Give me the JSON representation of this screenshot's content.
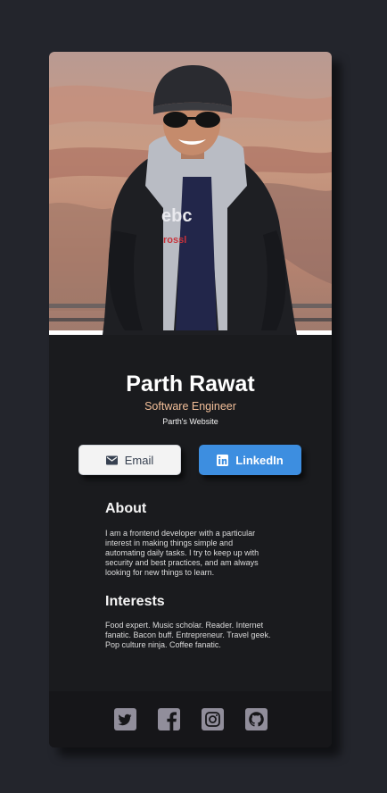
{
  "profile": {
    "name": "Parth Rawat",
    "title": "Software Engineer",
    "website_label": "Parth's Website"
  },
  "buttons": {
    "email_label": "Email",
    "linkedin_label": "LinkedIn"
  },
  "about": {
    "heading": "About",
    "text": "I am a frontend developer with a particular interest in making things simple and automating daily tasks. I try to keep up with security and best practices, and am always looking for new things to learn."
  },
  "interests": {
    "heading": "Interests",
    "text": "Food expert. Music scholar. Reader. Internet fanatic. Bacon buff. Entrepreneur. Travel geek. Pop culture ninja. Coffee fanatic."
  },
  "social": [
    "twitter-icon",
    "facebook-icon",
    "instagram-icon",
    "github-icon"
  ],
  "colors": {
    "page_bg": "#23252c",
    "card_bg": "#1a1b1e",
    "footer_bg": "#161619",
    "accent_title": "#f3bf99",
    "linkedin_blue": "#3d8ee0",
    "icon_gray": "#918e9b"
  }
}
